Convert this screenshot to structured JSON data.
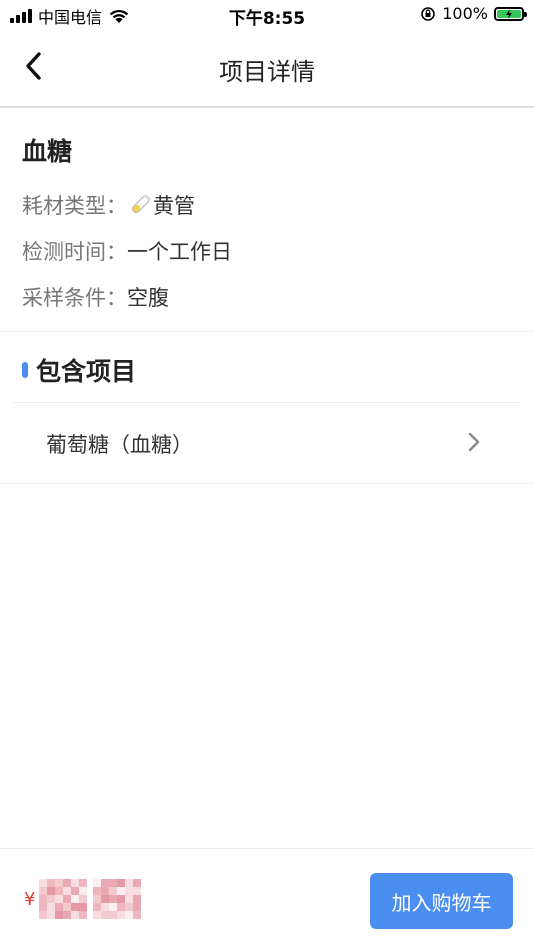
{
  "status_bar": {
    "carrier": "中国电信",
    "time": "下午8:55",
    "battery": "100%",
    "icons": [
      "signal-icon",
      "wifi-icon",
      "orientation-lock-icon",
      "battery-charging-icon"
    ]
  },
  "nav": {
    "title": "项目详情",
    "back_icon": "back-chevron-icon"
  },
  "item": {
    "name": "血糖",
    "consumable_label": "耗材类型：",
    "consumable_value": "黄管",
    "consumable_icon": "test-tube-icon",
    "consumable_color": "#f3d54a",
    "detect_time_label": "检测时间：",
    "detect_time_value": "一个工作日",
    "sampling_label": "采样条件：",
    "sampling_value": "空腹"
  },
  "included": {
    "title": "包含项目",
    "accent_color": "#4a8ff0",
    "items": [
      {
        "label": "葡萄糖（血糖）"
      }
    ]
  },
  "bottom": {
    "currency": "¥",
    "cart_button": "加入购物车",
    "button_color": "#4a8ff0",
    "price_color": "#e83b2e"
  }
}
